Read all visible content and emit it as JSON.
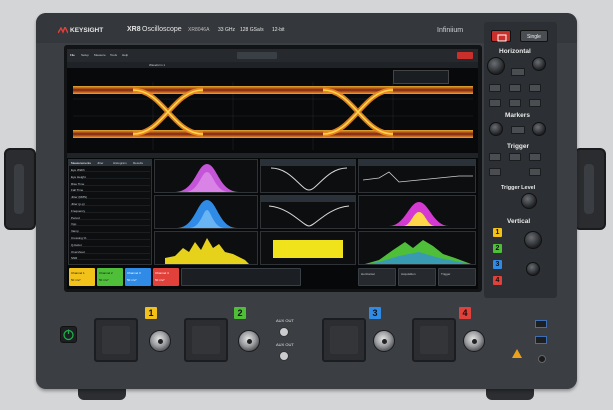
{
  "brand": {
    "logo_text": "KEYSIGHT",
    "series": "XR8",
    "product": "Oscilloscope",
    "model": "XR8046A",
    "spec_bw": "33 GHz",
    "spec_rate": "128 GSa/s",
    "spec_bits": "12-bit",
    "product_line": "Infiniium"
  },
  "screen": {
    "menu": [
      "File",
      "Setup",
      "Measure",
      "Tools",
      "Help"
    ],
    "waveform_title": "Waveform 1",
    "tabs": [
      "Measurements",
      "Jitter",
      "Histogram",
      "Results"
    ],
    "table_rows": [
      "Eye Width",
      "Eye Height",
      "Rise Time",
      "Fall Time",
      "Jitter (RMS)",
      "Jitter (p-p)",
      "Frequency",
      "Period",
      "Vpp",
      "Vamp",
      "Crossing %",
      "Q-factor",
      "Overshoot",
      "SNR"
    ],
    "channel_chips": [
      {
        "label": "Channel 1",
        "value": "50 mV/",
        "color": "#f2c21b"
      },
      {
        "label": "Channel 2",
        "value": "50 mV/",
        "color": "#4fbf3a"
      },
      {
        "label": "Channel 3",
        "value": "50 mV/",
        "color": "#2f8be6"
      },
      {
        "label": "Channel 4",
        "value": "50 mV/",
        "color": "#e0413a"
      }
    ],
    "bottom_right": [
      "Horizontal",
      "Acquisition",
      "Trigger"
    ]
  },
  "controls": {
    "sections": [
      "Horizontal",
      "Markers",
      "Trigger",
      "Trigger Level",
      "Vertical"
    ],
    "top_buttons": [
      "Single"
    ],
    "vertical_keys": [
      "1",
      "2",
      "3",
      "4"
    ]
  },
  "front": {
    "channels": [
      "1",
      "2",
      "3",
      "4"
    ],
    "aux_top": "AUX OUT",
    "aux_bottom": "AUX OUT"
  },
  "colors": {
    "ch1": "#f2c21b",
    "ch2": "#4fbf3a",
    "ch3": "#2f8be6",
    "ch4": "#e0413a",
    "power": "#19b34a"
  }
}
